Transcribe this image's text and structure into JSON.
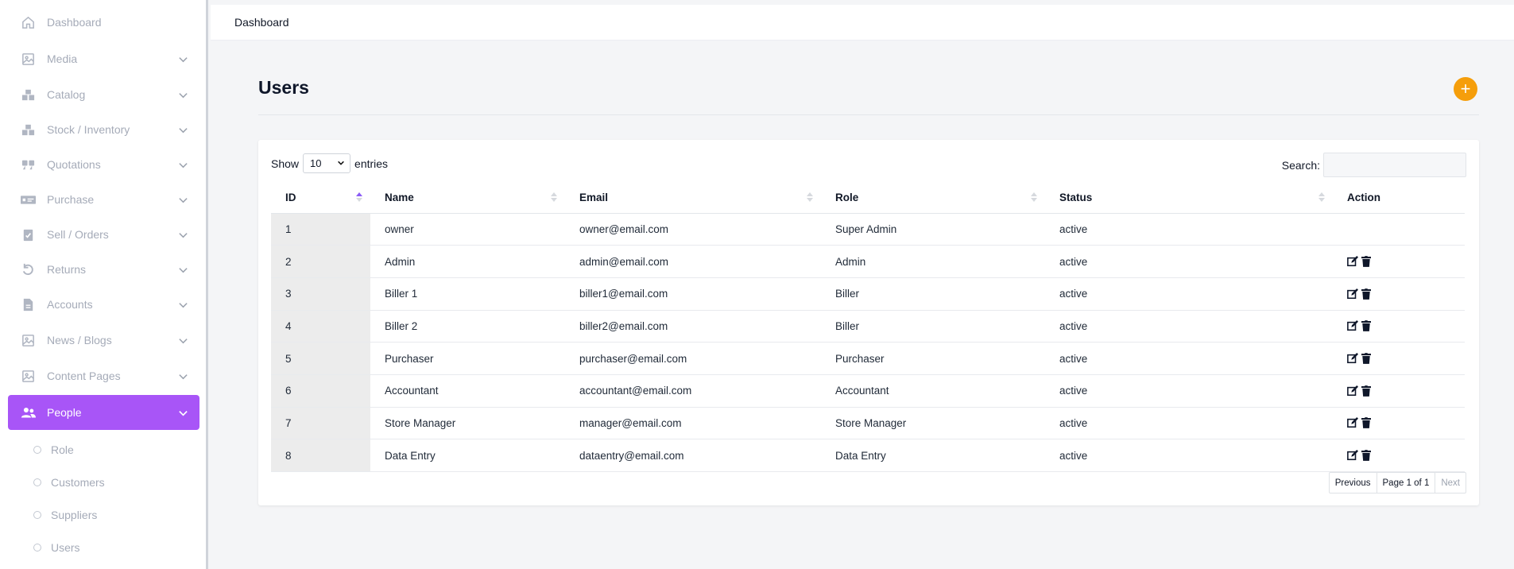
{
  "sidebar": {
    "items": [
      {
        "label": "Dashboard",
        "icon": "home-icon"
      },
      {
        "label": "Media",
        "icon": "image-icon"
      },
      {
        "label": "Catalog",
        "icon": "boxes-icon"
      },
      {
        "label": "Stock / Inventory",
        "icon": "boxes-icon"
      },
      {
        "label": "Quotations",
        "icon": "quote-icon"
      },
      {
        "label": "Purchase",
        "icon": "money-check-icon"
      },
      {
        "label": "Sell / Orders",
        "icon": "clipboard-check-icon"
      },
      {
        "label": "Returns",
        "icon": "undo-icon"
      },
      {
        "label": "Accounts",
        "icon": "file-invoice-icon"
      },
      {
        "label": "News / Blogs",
        "icon": "image-icon"
      },
      {
        "label": "Content Pages",
        "icon": "image-icon"
      },
      {
        "label": "People",
        "icon": "users-icon"
      }
    ],
    "people_sub": [
      "Role",
      "Customers",
      "Suppliers",
      "Users"
    ]
  },
  "topbar": {
    "breadcrumb": "Dashboard"
  },
  "page": {
    "title": "Users",
    "add_symbol": "+"
  },
  "table_controls": {
    "show_label": "Show",
    "entries_value": "10",
    "entries_label": "entries",
    "search_label": "Search:"
  },
  "table": {
    "headers": [
      "ID",
      "Name",
      "Email",
      "Role",
      "Status",
      "Action"
    ],
    "rows": [
      {
        "id": "1",
        "name": "owner",
        "email": "owner@email.com",
        "role": "Super Admin",
        "status": "active",
        "actions": false
      },
      {
        "id": "2",
        "name": "Admin",
        "email": "admin@email.com",
        "role": "Admin",
        "status": "active",
        "actions": true
      },
      {
        "id": "3",
        "name": "Biller 1",
        "email": "biller1@email.com",
        "role": "Biller",
        "status": "active",
        "actions": true
      },
      {
        "id": "4",
        "name": "Biller 2",
        "email": "biller2@email.com",
        "role": "Biller",
        "status": "active",
        "actions": true
      },
      {
        "id": "5",
        "name": "Purchaser",
        "email": "purchaser@email.com",
        "role": "Purchaser",
        "status": "active",
        "actions": true
      },
      {
        "id": "6",
        "name": "Accountant",
        "email": "accountant@email.com",
        "role": "Accountant",
        "status": "active",
        "actions": true
      },
      {
        "id": "7",
        "name": "Store Manager",
        "email": "manager@email.com",
        "role": "Store Manager",
        "status": "active",
        "actions": true
      },
      {
        "id": "8",
        "name": "Data Entry",
        "email": "dataentry@email.com",
        "role": "Data Entry",
        "status": "active",
        "actions": true
      }
    ]
  },
  "pagination": {
    "previous": "Previous",
    "page_info": "Page 1 of 1",
    "next": "Next"
  },
  "colors": {
    "active_nav": "#a855f7",
    "add_button": "#f59e0b",
    "sort_active": "#8b5cf6"
  }
}
